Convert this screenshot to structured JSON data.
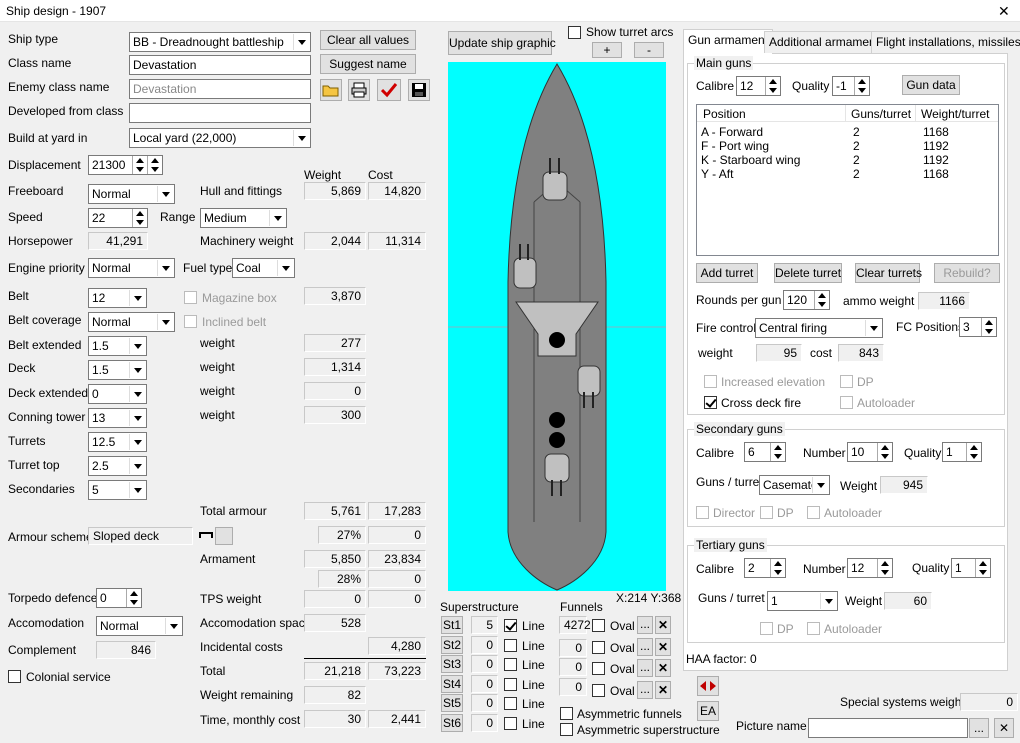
{
  "window": {
    "title": "Ship design - 1907",
    "close": "✕"
  },
  "left": {
    "ship_type_label": "Ship type",
    "ship_type": "BB - Dreadnought battleship",
    "class_name_label": "Class name",
    "class_name": "Devastation",
    "enemy_label": "Enemy class name",
    "enemy_placeholder": "Devastation",
    "developed_label": "Developed from class",
    "developed": "",
    "yard_label": "Build at yard in",
    "yard": "Local yard (22,000)",
    "clear_btn": "Clear all values",
    "suggest_btn": "Suggest name",
    "disp_label": "Displacement",
    "disp": "21300",
    "weight_hdr": "Weight",
    "cost_hdr": "Cost",
    "freeboard_label": "Freeboard",
    "freeboard": "Normal",
    "hull_label": "Hull and fittings",
    "hull_w": "5,869",
    "hull_c": "14,820",
    "speed_label": "Speed",
    "speed": "22",
    "range_label": "Range",
    "range": "Medium",
    "hp_label": "Horsepower",
    "hp": "41,291",
    "mach_label": "Machinery weight",
    "mach_w": "2,044",
    "mach_c": "11,314",
    "engine_label": "Engine priority",
    "engine": "Normal",
    "fuel_label": "Fuel type",
    "fuel": "Coal",
    "belt_label": "Belt",
    "belt": "12",
    "magbox_label": "Magazine box",
    "magbox_w": "3,870",
    "beltcov_label": "Belt coverage",
    "beltcov": "Normal",
    "incl_label": "Inclined belt",
    "beltext_label": "Belt extended",
    "beltext": "1.5",
    "w1_label": "weight",
    "w1": "277",
    "deck_label": "Deck",
    "deck": "1.5",
    "w2_label": "weight",
    "w2": "1,314",
    "deckext_label": "Deck extended",
    "deckext": "0",
    "w3_label": "weight",
    "w3": "0",
    "ct_label": "Conning tower",
    "ct": "13",
    "w4_label": "weight",
    "w4": "300",
    "turrets_label": "Turrets",
    "turrets": "12.5",
    "turtop_label": "Turret top",
    "turtop": "2.5",
    "secs_label": "Secondaries",
    "secs": "5",
    "totarm_label": "Total armour",
    "totarm_w": "5,761",
    "totarm_c": "17,283",
    "scheme_label": "Armour scheme",
    "scheme": "Sloped deck",
    "pct1": "27%",
    "pct1c": "0",
    "armament_label": "Armament",
    "arm_w": "5,850",
    "arm_c": "23,834",
    "pct2": "28%",
    "pct2c": "0",
    "torp_label": "Torpedo defence",
    "torp": "0",
    "tps_label": "TPS weight",
    "tps_w": "0",
    "tps_c": "0",
    "accom_label": "Accomodation",
    "accom": "Normal",
    "accsp_label": "Accomodation space",
    "accsp": "528",
    "comp_label": "Complement",
    "comp": "846",
    "inc_label": "Incidental costs",
    "inc_c": "4,280",
    "colonial_label": "Colonial service",
    "total_label": "Total",
    "total_w": "21,218",
    "total_c": "73,223",
    "wrem_label": "Weight remaining",
    "wrem": "82",
    "time_label": "Time, monthly cost",
    "time_w": "30",
    "time_c": "2,441"
  },
  "center": {
    "update_btn": "Update ship graphic",
    "turret_arcs": "Show turret arcs",
    "plus": "+",
    "minus": "-",
    "coords": "X:214 Y:368",
    "super_label": "Superstructure",
    "funnels_label": "Funnels",
    "st": [
      {
        "b": "St1",
        "v": "5",
        "line": true,
        "f": "4272"
      },
      {
        "b": "St2",
        "v": "0",
        "line": false,
        "f": "0"
      },
      {
        "b": "St3",
        "v": "0",
        "line": false,
        "f": "0"
      },
      {
        "b": "St4",
        "v": "0",
        "line": false,
        "f": "0"
      },
      {
        "b": "St5",
        "v": "0",
        "line": false,
        "f": ""
      },
      {
        "b": "St6",
        "v": "0",
        "line": false,
        "f": ""
      }
    ],
    "line_label": "Line",
    "oval_label": "Oval",
    "dots": "...",
    "x": "✕",
    "asym_f": "Asymmetric funnels",
    "asym_s": "Asymmetric superstructure"
  },
  "right": {
    "tabs": [
      "Gun armament",
      "Additional armament",
      "Flight installations, missiles"
    ],
    "main_label": "Main guns",
    "cal_label": "Calibre",
    "cal": "12",
    "qual_label": "Quality",
    "qual": "-1",
    "gundata_btn": "Gun data",
    "cols": [
      "Position",
      "Guns/turret",
      "Weight/turret"
    ],
    "rows": [
      [
        "A - Forward",
        "2",
        "1168"
      ],
      [
        "F - Port wing",
        "2",
        "1192"
      ],
      [
        "K - Starboard wing",
        "2",
        "1192"
      ],
      [
        "Y - Aft",
        "2",
        "1168"
      ]
    ],
    "add_btn": "Add turret",
    "del_btn": "Delete turret",
    "clr_btn": "Clear turrets",
    "rebuild_btn": "Rebuild?",
    "rpg_label": "Rounds per gun",
    "rpg": "120",
    "ammo_label": "ammo weight",
    "ammo": "1166",
    "fc_label": "Fire control",
    "fc": "Central firing",
    "fcpos_label": "FC Positions",
    "fcpos": "3",
    "weight_label": "weight",
    "fc_w": "95",
    "cost_label": "cost",
    "fc_c": "843",
    "incel_label": "Increased elevation",
    "dp_label": "DP",
    "cdf_label": "Cross deck fire",
    "auto_label": "Autoloader",
    "sec_label": "Secondary guns",
    "scal": "6",
    "num_label": "Number",
    "snum": "10",
    "squal": "1",
    "gpt_label": "Guns / turret",
    "sgpt": "Casemates",
    "sweight_label": "Weight",
    "sw": "945",
    "dir_label": "Director",
    "ter_label": "Tertiary guns",
    "tcal": "2",
    "tnum": "12",
    "tqual": "1",
    "tgpt": "1",
    "tw": "60",
    "haa": "HAA factor: 0",
    "ea": "EA",
    "special_label": "Special systems weight",
    "special": "0",
    "pic_label": "Picture name",
    "pic": ""
  },
  "colors": {
    "sea": "#00ffff",
    "hull": "#808080",
    "deck": "#c0c0c0"
  }
}
